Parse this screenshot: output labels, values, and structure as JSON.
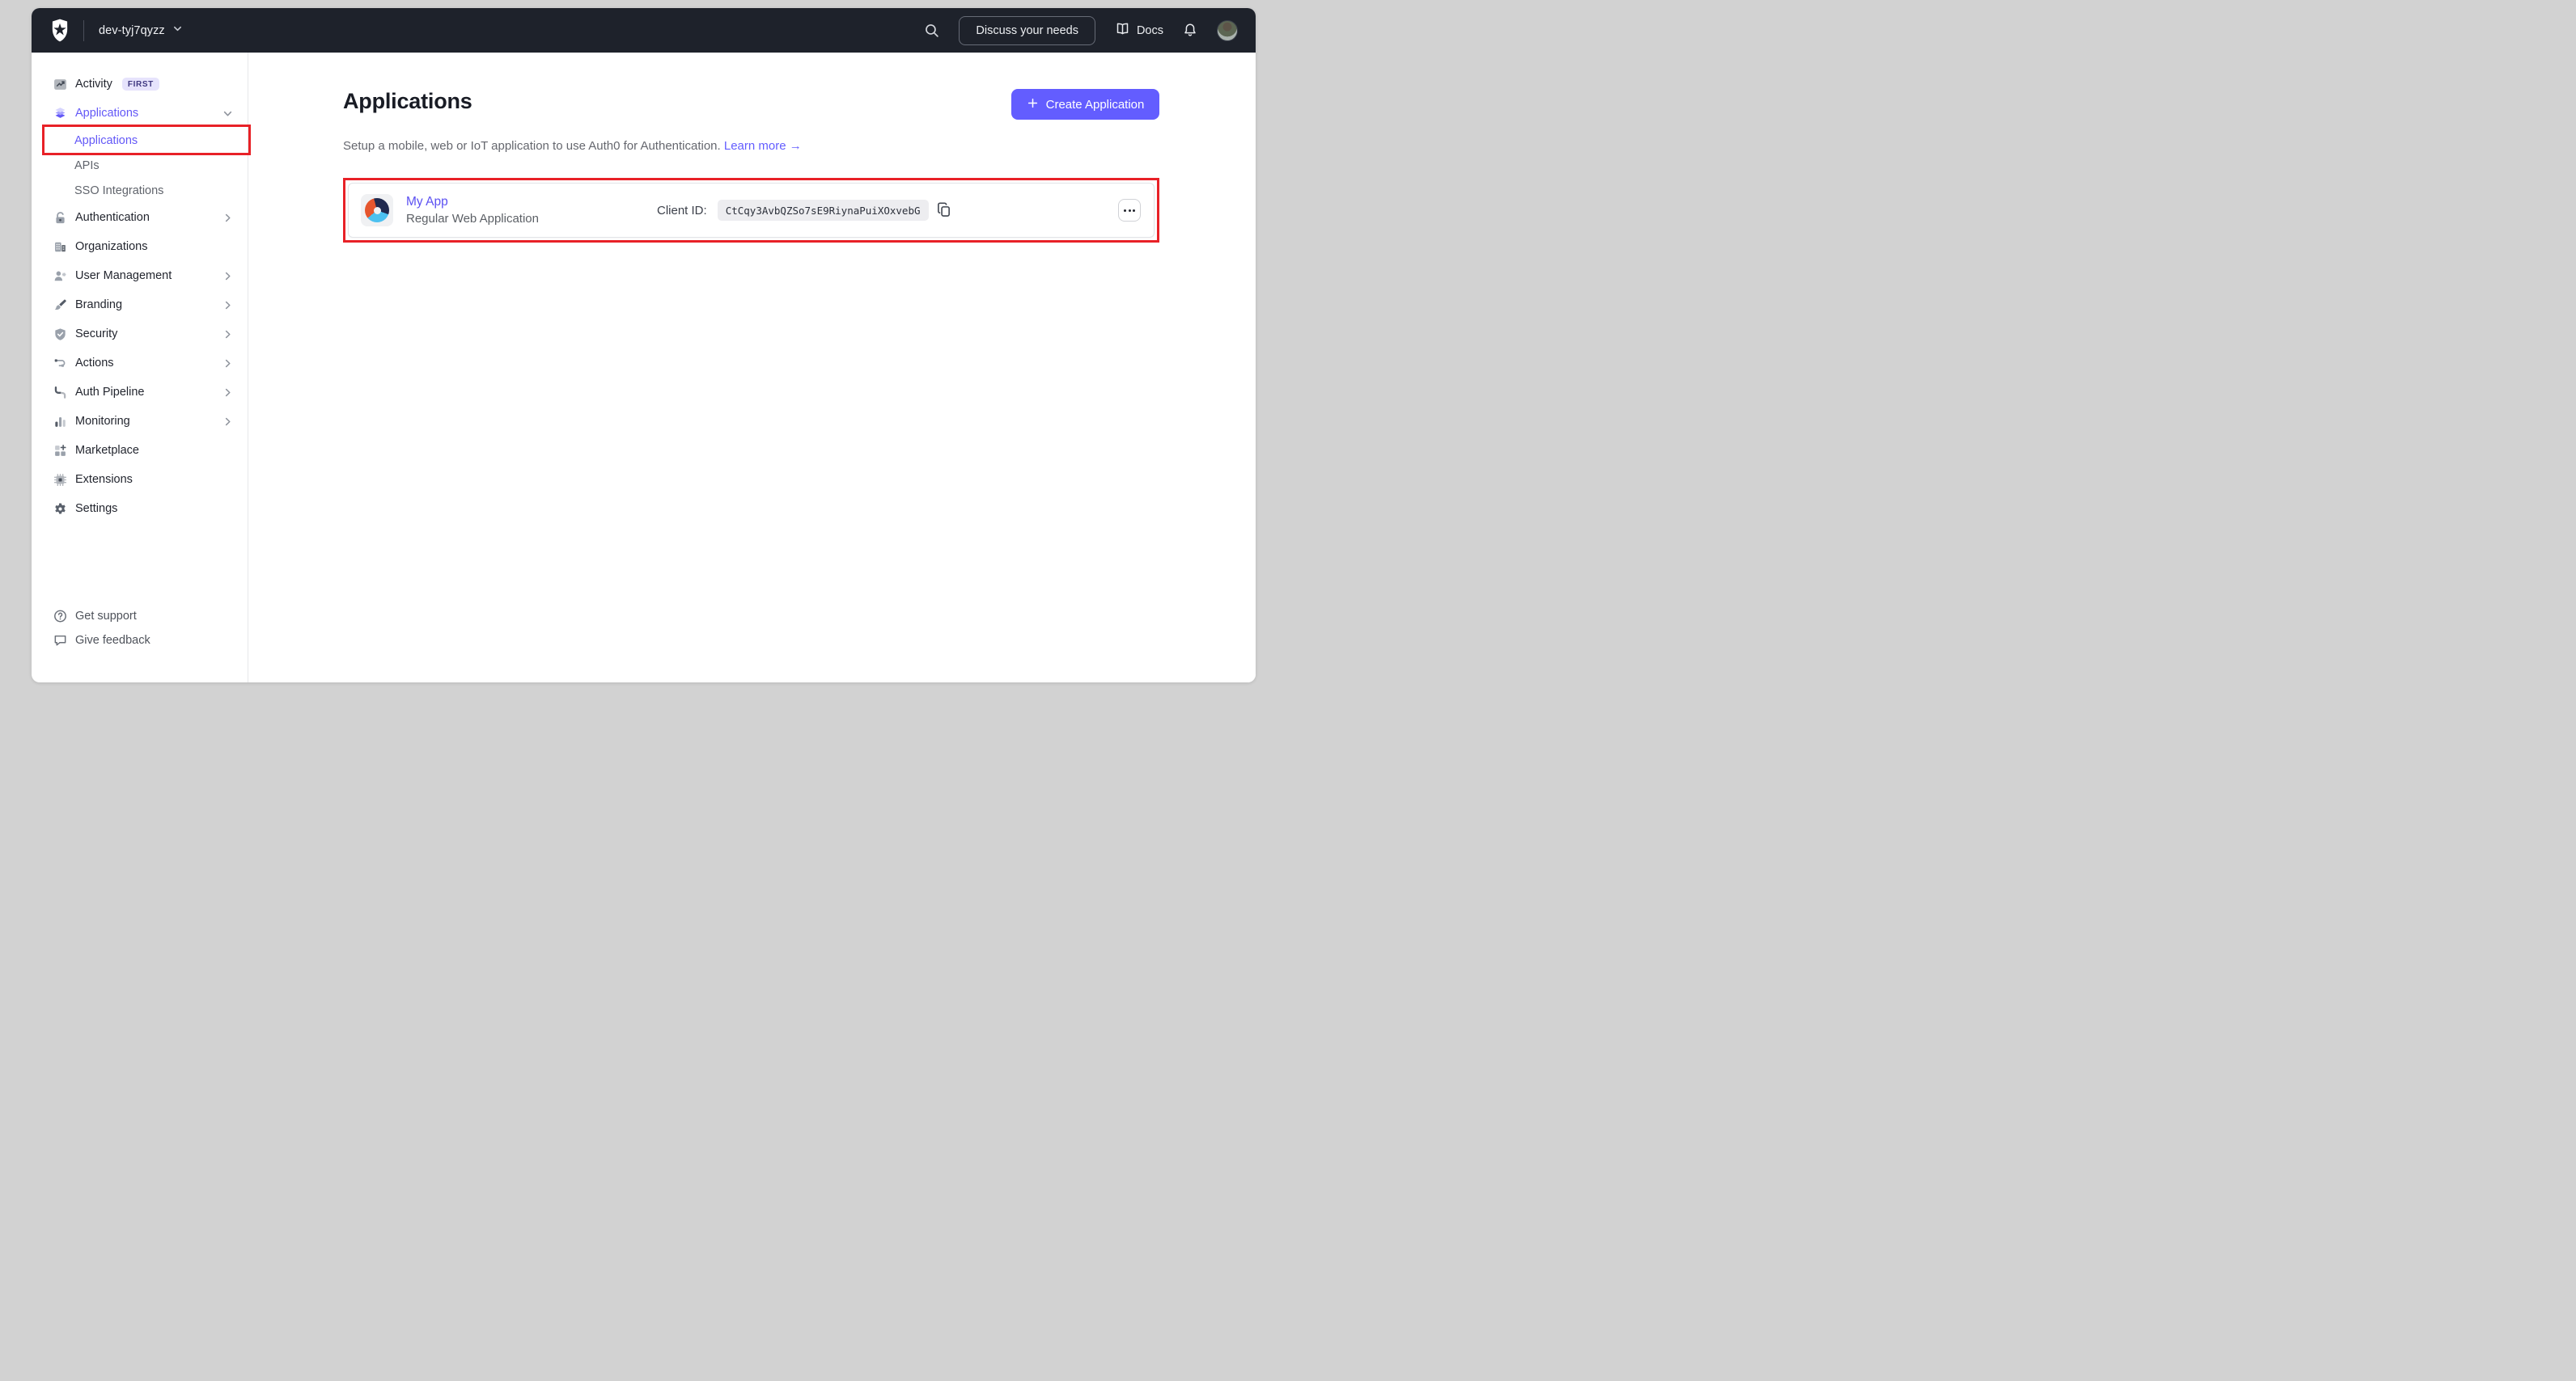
{
  "topbar": {
    "tenant": "dev-tyj7qyzz",
    "discuss_button": "Discuss your needs",
    "docs_label": "Docs"
  },
  "sidebar": {
    "items": [
      {
        "label": "Activity",
        "icon": "activity-icon",
        "badge": "FIRST"
      },
      {
        "label": "Applications",
        "icon": "applications-icon",
        "chevron": "down",
        "active": true,
        "children": [
          {
            "label": "Applications",
            "active": true,
            "annotated": true
          },
          {
            "label": "APIs"
          },
          {
            "label": "SSO Integrations"
          }
        ]
      },
      {
        "label": "Authentication",
        "icon": "authentication-icon",
        "chevron": "right"
      },
      {
        "label": "Organizations",
        "icon": "organizations-icon"
      },
      {
        "label": "User Management",
        "icon": "user-management-icon",
        "chevron": "right"
      },
      {
        "label": "Branding",
        "icon": "branding-icon",
        "chevron": "right"
      },
      {
        "label": "Security",
        "icon": "security-icon",
        "chevron": "right"
      },
      {
        "label": "Actions",
        "icon": "actions-icon",
        "chevron": "right"
      },
      {
        "label": "Auth Pipeline",
        "icon": "auth-pipeline-icon",
        "chevron": "right"
      },
      {
        "label": "Monitoring",
        "icon": "monitoring-icon",
        "chevron": "right"
      },
      {
        "label": "Marketplace",
        "icon": "marketplace-icon"
      },
      {
        "label": "Extensions",
        "icon": "extensions-icon"
      },
      {
        "label": "Settings",
        "icon": "settings-icon"
      }
    ],
    "footer": [
      {
        "label": "Get support",
        "icon": "help-icon"
      },
      {
        "label": "Give feedback",
        "icon": "feedback-icon"
      }
    ]
  },
  "main": {
    "title": "Applications",
    "create_button": "Create Application",
    "subtitle": "Setup a mobile, web or IoT application to use Auth0 for Authentication.",
    "learn_more": "Learn more",
    "learn_more_arrow": "→",
    "app": {
      "name": "My App",
      "type": "Regular Web Application",
      "client_id_label": "Client ID:",
      "client_id": "CtCqy3AvbQZSo7sE9RiynaPuiXOxvebG"
    }
  },
  "colors": {
    "accent": "#635dff",
    "navbar_bg": "#1e222b",
    "page_bg": "#d2d2d2",
    "annotation": "#e82127"
  }
}
